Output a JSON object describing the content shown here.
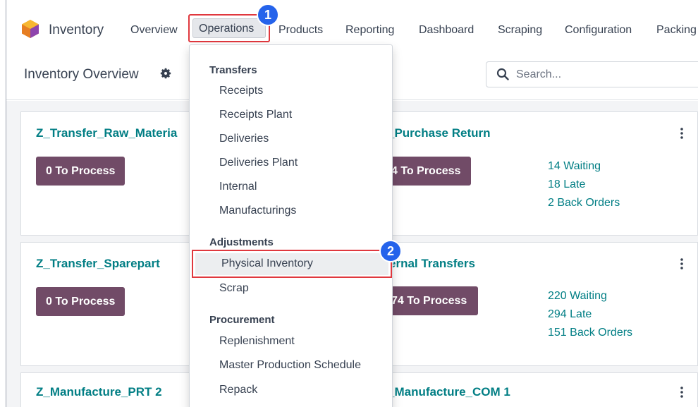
{
  "app": {
    "name": "Inventory"
  },
  "navbar": {
    "items": [
      {
        "label": "Overview"
      },
      {
        "label": "Operations"
      },
      {
        "label": "Products"
      },
      {
        "label": "Reporting"
      },
      {
        "label": "Dashboard"
      },
      {
        "label": "Scraping"
      },
      {
        "label": "Configuration"
      },
      {
        "label": "Packing"
      }
    ]
  },
  "page": {
    "title": "Inventory Overview"
  },
  "search": {
    "placeholder": "Search..."
  },
  "steps": {
    "one": "1",
    "two": "2"
  },
  "dropdown": {
    "sections": [
      {
        "header": "Transfers",
        "items": [
          "Receipts",
          "Receipts Plant",
          "Deliveries",
          "Deliveries Plant",
          "Internal",
          "Manufacturings"
        ]
      },
      {
        "header": "Adjustments",
        "items": [
          "Physical Inventory",
          "Scrap"
        ]
      },
      {
        "header": "Procurement",
        "items": [
          "Replenishment",
          "Master Production Schedule",
          "Repack"
        ]
      }
    ]
  },
  "cards": [
    {
      "title": "Z_Transfer_Raw_Materia",
      "button": "0 To Process"
    },
    {
      "title": "_Purchase Return",
      "button": "4 To Process",
      "stats": [
        "14 Waiting",
        "18 Late",
        "2 Back Orders"
      ]
    },
    {
      "title": "Z_Transfer_Sparepart",
      "button": "0 To Process"
    },
    {
      "title": "ernal Transfers",
      "button": "74 To Process",
      "stats": [
        "220 Waiting",
        "294 Late",
        "151 Back Orders"
      ]
    },
    {
      "title": "Z_Manufacture_PRT 2"
    },
    {
      "title": "_Manufacture_COM 1"
    }
  ],
  "colors": {
    "brand": "#714b67",
    "link": "#017e84",
    "highlight": "#e0383e",
    "step_badge": "#2563eb"
  }
}
